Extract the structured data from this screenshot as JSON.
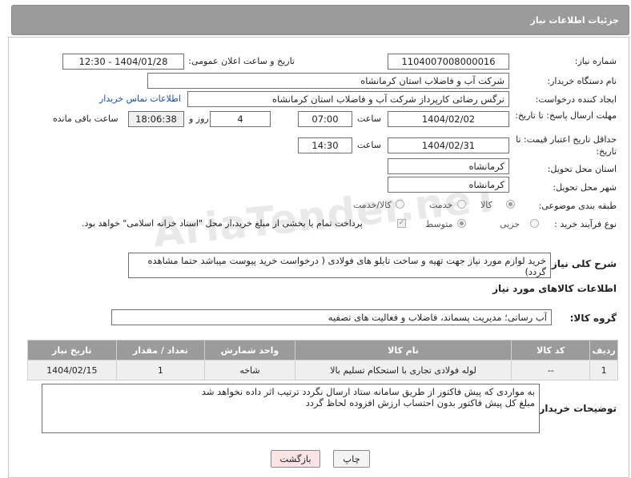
{
  "header": {
    "title": "جزئیات اطلاعات نیاز"
  },
  "fields": {
    "need_number_label": "شماره نیاز:",
    "need_number": "1104007008000016",
    "announce_label": "تاریخ و ساعت اعلان عمومی:",
    "announce_value": "1404/01/28 - 12:30",
    "buyer_org_label": "نام دستگاه خریدار:",
    "buyer_org": "شرکت آب و فاضلاب استان کرمانشاه",
    "creator_label": "ایجاد کننده درخواست:",
    "creator": "نرگس رضائی کارپرداز شرکت آب و فاضلاب استان کرمانشاه",
    "contact_link": "اطلاعات تماس خریدار",
    "reply_deadline_label": "مهلت ارسال پاسخ: تا تاریخ:",
    "reply_date": "1404/02/02",
    "time_label": "ساعت",
    "reply_time": "07:00",
    "days_value": "4",
    "days_label": "روز و",
    "remaining_time": "18:06:38",
    "remaining_label": "ساعت باقی مانده",
    "price_validity_label": "حداقل تاریخ اعتبار قیمت: تا تاریخ:",
    "price_date": "1404/02/31",
    "price_time": "14:30",
    "province_label": "استان محل تحویل:",
    "province": "کرمانشاه",
    "city_label": "شهر محل تحویل:",
    "city": "کرمانشاه",
    "category_label": "طبقه بندی موضوعی:",
    "category_options": [
      "کالا",
      "خدمت",
      "کالا/خدمت"
    ],
    "process_label": "نوع فرآیند خرید :",
    "process_options": [
      "جزیی",
      "متوسط"
    ],
    "payment_note": "پرداخت تمام یا بخشی از مبلغ خرید،از محل \"اسناد خزانه اسلامی\" خواهد بود.",
    "description_label": "شرح کلی نیاز:",
    "description": "خرید لوازم مورد نیاز جهت تهیه و ساخت تابلو های فولادی ( درخواست خرید پیوست میباشد حتما مشاهده گردد)"
  },
  "goods": {
    "section_title": "اطلاعات کالاهای مورد نیاز",
    "group_label": "گروه کالا:",
    "group_value": "آب رسانی؛ مدیریت پسماند، فاضلاب و فعالیت های تصفیه",
    "columns": [
      "ردیف",
      "کد کالا",
      "نام کالا",
      "واحد شمارش",
      "تعداد / مقدار",
      "تاریخ نیاز"
    ],
    "rows": [
      [
        "1",
        "--",
        "لوله فولادی تجاری با استحکام تسلیم بالا",
        "شاخه",
        "1",
        "1404/02/15"
      ]
    ]
  },
  "buyer_notes": {
    "label": "توضیحات خریدار:",
    "line1": "به مواردی که پیش فاکتور از طریق سامانه ستاد ارسال نگردد ترتیب اثر داده نخواهد شد",
    "line2": "مبلغ کل پیش فاکتور بدون احتساب ارزش افزوده لحاظ گردد"
  },
  "buttons": {
    "print": "چاپ",
    "back": "بازگشت"
  },
  "watermark": "AriaTender.neT"
}
